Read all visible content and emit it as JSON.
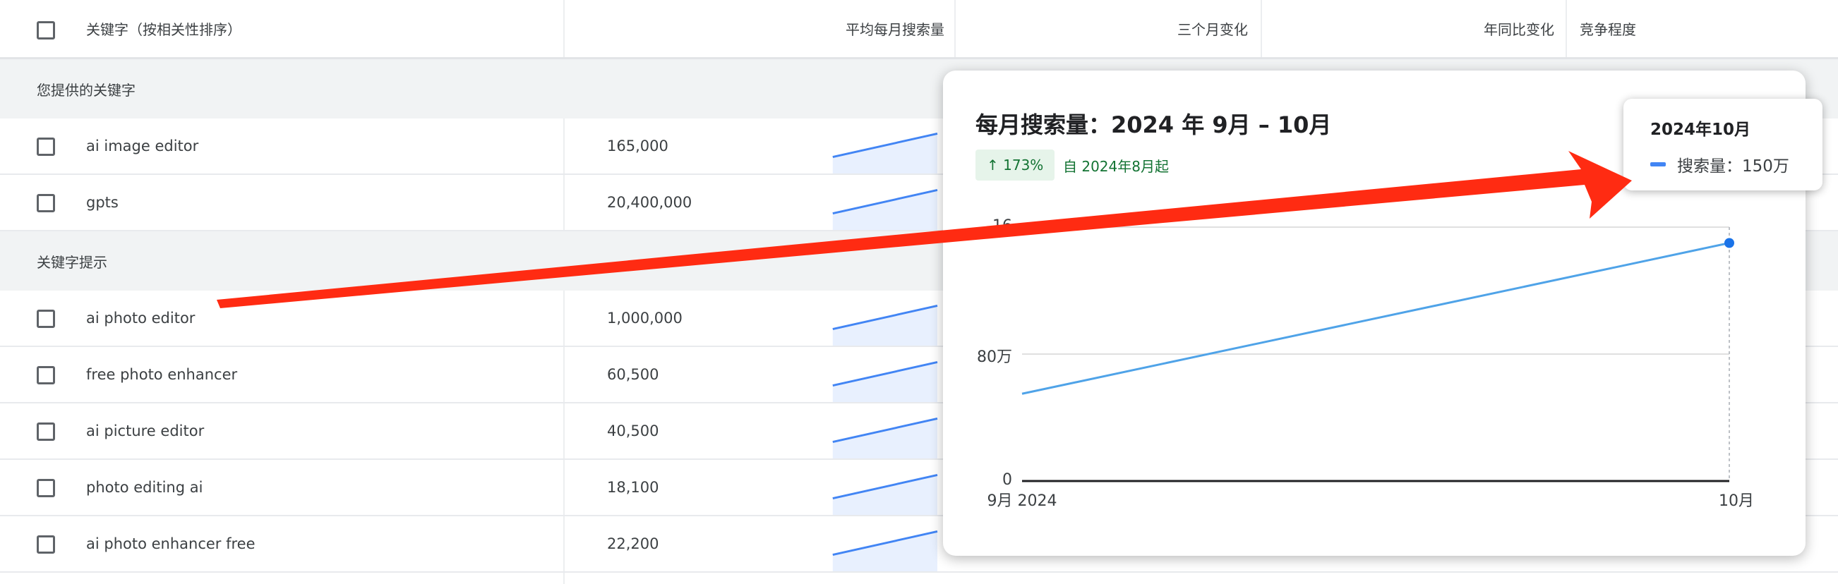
{
  "table": {
    "header": {
      "keyword_col": "关键字（按相关性排序）",
      "avg_monthly_col": "平均每月搜索量",
      "three_month_col": "三个月变化",
      "yoy_col": "年同比变化",
      "competition_col": "竞争程度"
    },
    "sections": [
      {
        "label": "您提供的关键字"
      },
      {
        "label": "关键字提示"
      }
    ],
    "provided_rows": [
      {
        "keyword": "ai image editor",
        "volume": "165,000"
      },
      {
        "keyword": "gpts",
        "volume": "20,400,000"
      }
    ],
    "suggestion_rows": [
      {
        "keyword": "ai photo editor",
        "volume": "1,000,000"
      },
      {
        "keyword": "free photo enhancer",
        "volume": "60,500"
      },
      {
        "keyword": "ai picture editor",
        "volume": "40,500"
      },
      {
        "keyword": "photo editing ai",
        "volume": "18,100"
      },
      {
        "keyword": "ai photo enhancer free",
        "volume": "22,200"
      }
    ]
  },
  "popup": {
    "title": "每月搜索量：2024 年 9月 – 10月",
    "badge": "↑ 173%",
    "since": "自 2024年8月起",
    "tooltip": {
      "date": "2024年10月",
      "series_label": "搜索量：150万"
    }
  },
  "chart_data": {
    "type": "line",
    "x": [
      "9月 2024",
      "10月"
    ],
    "series": [
      {
        "name": "搜索量",
        "values": [
          550000,
          1500000
        ]
      }
    ],
    "y_ticks": [
      "0",
      "80万",
      "16"
    ],
    "ylim": [
      0,
      1600000
    ],
    "grid": true,
    "line_color": "#4fa3e8"
  },
  "colors": {
    "arrow": "#ff2b12",
    "accent": "#1a73e8",
    "positive": "#137333"
  }
}
